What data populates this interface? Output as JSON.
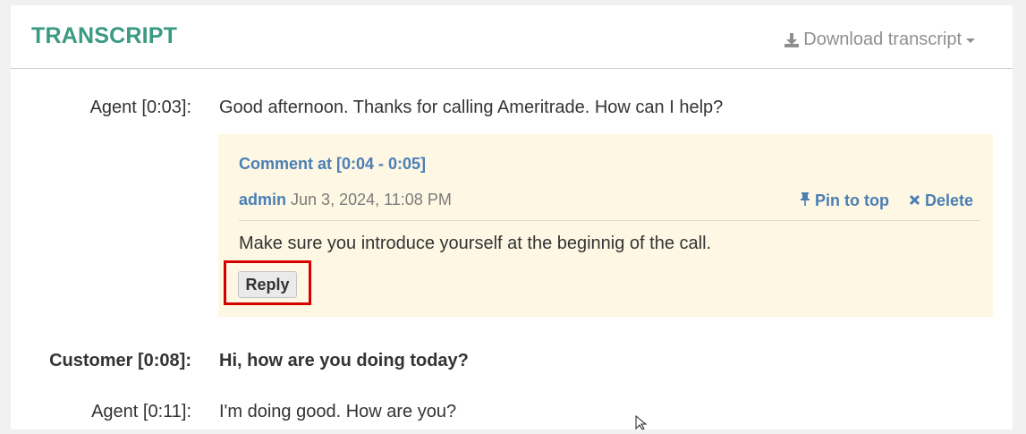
{
  "header": {
    "title": "TRANSCRIPT",
    "download_label": "Download transcript"
  },
  "transcript": [
    {
      "speaker": "Agent [0:03]:",
      "text": "Good afternoon. Thanks for calling Ameritrade. How can I help?",
      "bold": false
    },
    {
      "speaker": "Customer [0:08]:",
      "text": "Hi, how are you doing today?",
      "bold": true
    },
    {
      "speaker": "Agent [0:11]:",
      "text": "I'm doing good. How are you?",
      "bold": false
    }
  ],
  "comment": {
    "title": "Comment at [0:04 - 0:05]",
    "author": "admin",
    "date": "Jun 3, 2024, 11:08 PM",
    "pin_label": "Pin to top",
    "delete_label": "Delete",
    "text": "Make sure you introduce yourself at the beginnig of the call.",
    "reply_label": "Reply"
  },
  "colors": {
    "title": "#3a9a82",
    "link": "#4a7fb5",
    "comment_bg": "#fdf7e3",
    "highlight": "#d40000"
  },
  "icons": [
    "download-icon",
    "caret-down-icon",
    "pin-icon",
    "close-icon",
    "mouse-cursor-icon"
  ]
}
